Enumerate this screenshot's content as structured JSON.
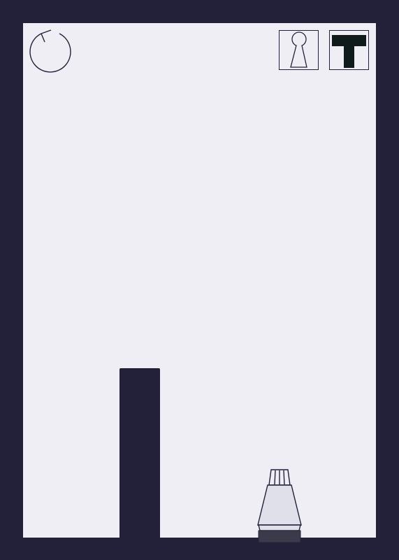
{
  "game": {
    "colors": {
      "frame": "#23213a",
      "playfield": "#eeeef4",
      "cannon_body": "#dfe0ea",
      "cannon_base": "#3b3a4a"
    },
    "icons": {
      "restart": "restart-arrow-icon",
      "keyhole": "keyhole-icon",
      "tetromino": "t-tetromino-icon",
      "cannon": "cannon-icon"
    }
  }
}
